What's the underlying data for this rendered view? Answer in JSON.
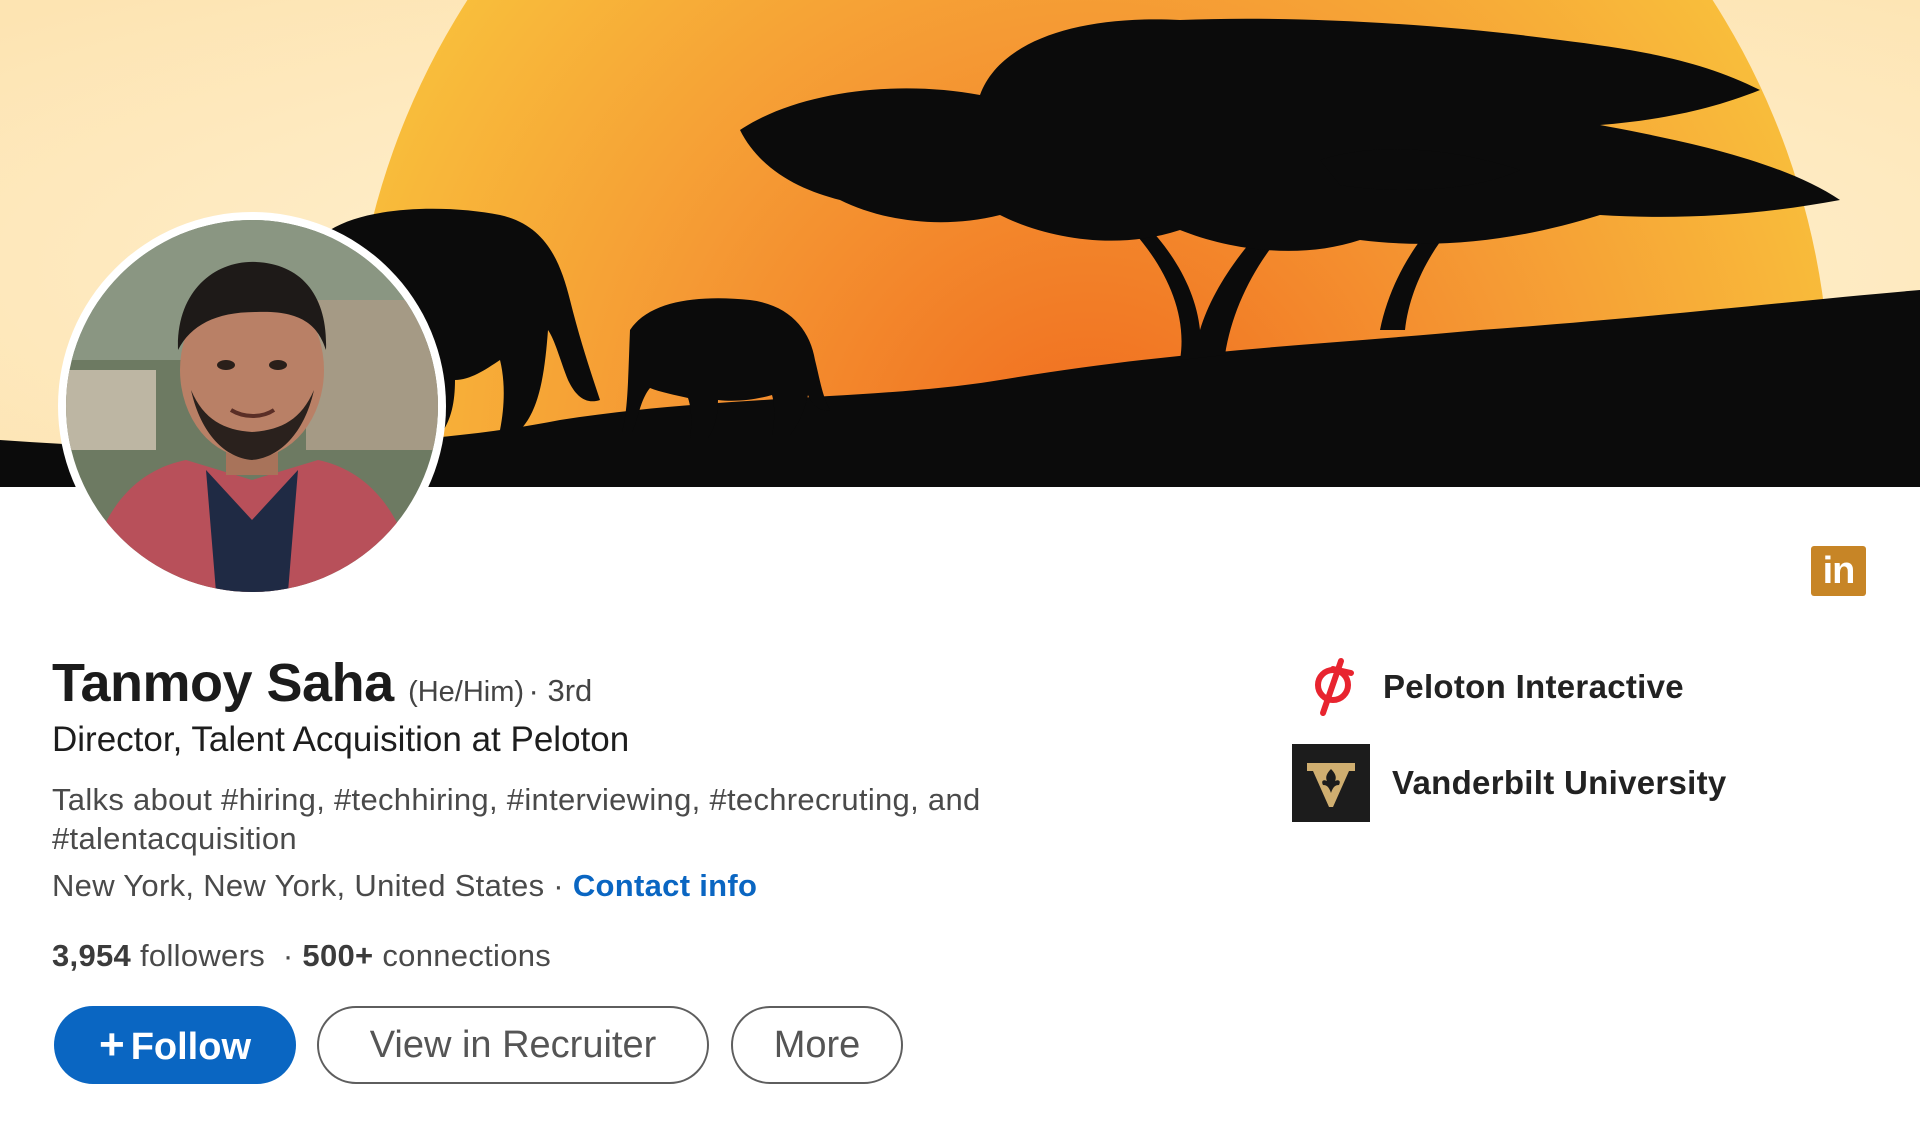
{
  "profile": {
    "name": "Tanmoy Saha",
    "pronouns": "(He/Him)",
    "degree": "· 3rd",
    "headline": "Director, Talent Acquisition at Peloton",
    "talks_about": "Talks about #hiring, #techhiring, #interviewing, #techrecruting, and #talentacquisition",
    "location": "New York, New York, United States",
    "separator": " · ",
    "contact_info": "Contact info",
    "followers_count": "3,954",
    "followers_label": "followers",
    "stat_separator": "·",
    "connections_count": "500+",
    "connections_label": "connections"
  },
  "actions": {
    "follow_plus": "+",
    "follow_label": "Follow",
    "recruiter_label": "View in Recruiter",
    "more_label": "More"
  },
  "badge": {
    "label": "in"
  },
  "organizations": [
    {
      "name": "Peloton Interactive",
      "icon": "peloton-logo-icon",
      "color": "#e8242f"
    },
    {
      "name": "Vanderbilt University",
      "icon": "vanderbilt-logo-icon",
      "color": "#cfae70"
    }
  ],
  "colors": {
    "primary": "#0a66c2",
    "badge": "#c78526",
    "banner_sun": "#f7a43a",
    "banner_sky": "#fde9bd"
  },
  "icons": {
    "banner": "savanna-sunset-banner",
    "avatar": "profile-photo"
  }
}
